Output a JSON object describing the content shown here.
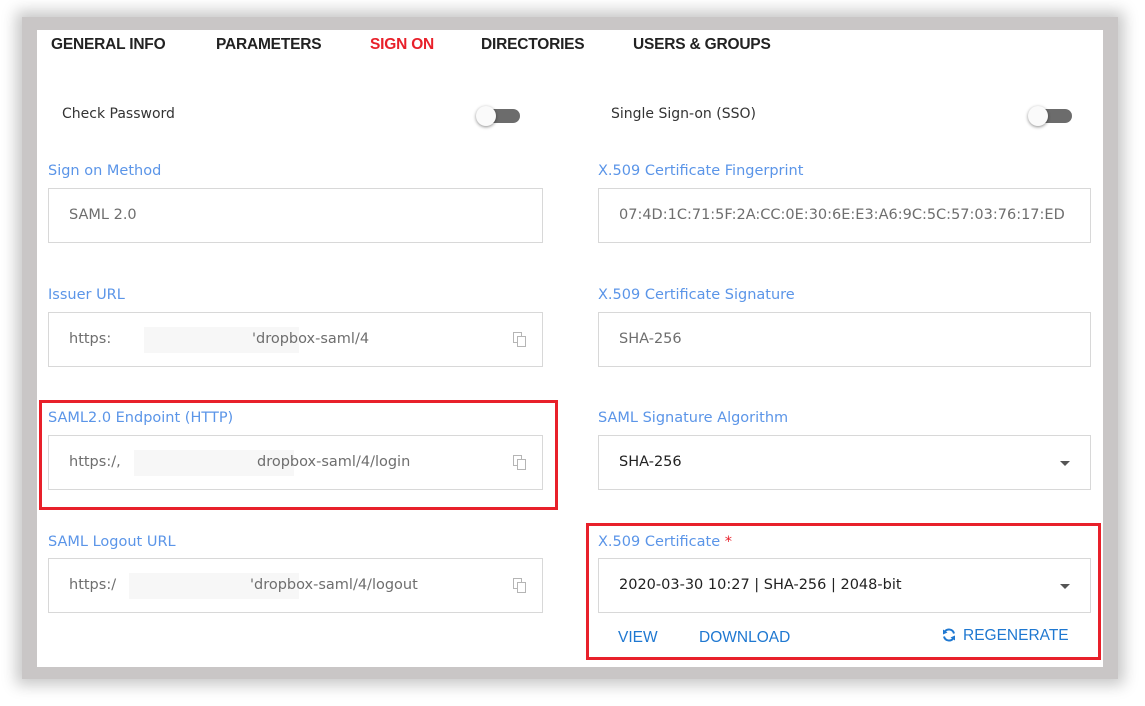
{
  "tabs": [
    "GENERAL INFO",
    "PARAMETERS",
    "SIGN ON",
    "DIRECTORIES",
    "USERS & GROUPS"
  ],
  "active_tab": "SIGN ON",
  "toggles": {
    "check_password": {
      "label": "Check Password",
      "enabled": false
    },
    "sso": {
      "label": "Single Sign-on (SSO)",
      "enabled": false
    }
  },
  "fields": {
    "sign_on_method": {
      "label": "Sign on Method",
      "value": "SAML 2.0"
    },
    "issuer_url": {
      "label": "Issuer URL",
      "prefix": "https:",
      "suffix": "dropbox-saml/4"
    },
    "endpoint": {
      "label": "SAML2.0 Endpoint (HTTP)",
      "prefix": "https:/,",
      "suffix": "dropbox-saml/4/login"
    },
    "logout_url": {
      "label": "SAML Logout URL",
      "prefix": "https:/",
      "suffix": "'dropbox-saml/4/logout"
    },
    "fingerprint": {
      "label": "X.509 Certificate Fingerprint",
      "value": "07:4D:1C:71:5F:2A:CC:0E:30:6E:E3:A6:9C:5C:57:03:76:17:ED"
    },
    "signature": {
      "label": "X.509 Certificate Signature",
      "value": "SHA-256"
    },
    "algorithm": {
      "label": "SAML Signature Algorithm",
      "value": "SHA-256"
    },
    "certificate": {
      "label": "X.509 Certificate",
      "required_mark": "*",
      "value": "2020-03-30 10:27 | SHA-256 | 2048-bit"
    }
  },
  "issuer_suffix_quote": "'",
  "actions": {
    "view": "VIEW",
    "download": "DOWNLOAD",
    "regenerate": "REGENERATE"
  },
  "colors": {
    "accent": "#e8202a",
    "label_blue": "#5b95e8",
    "link_blue": "#1f78d1"
  }
}
